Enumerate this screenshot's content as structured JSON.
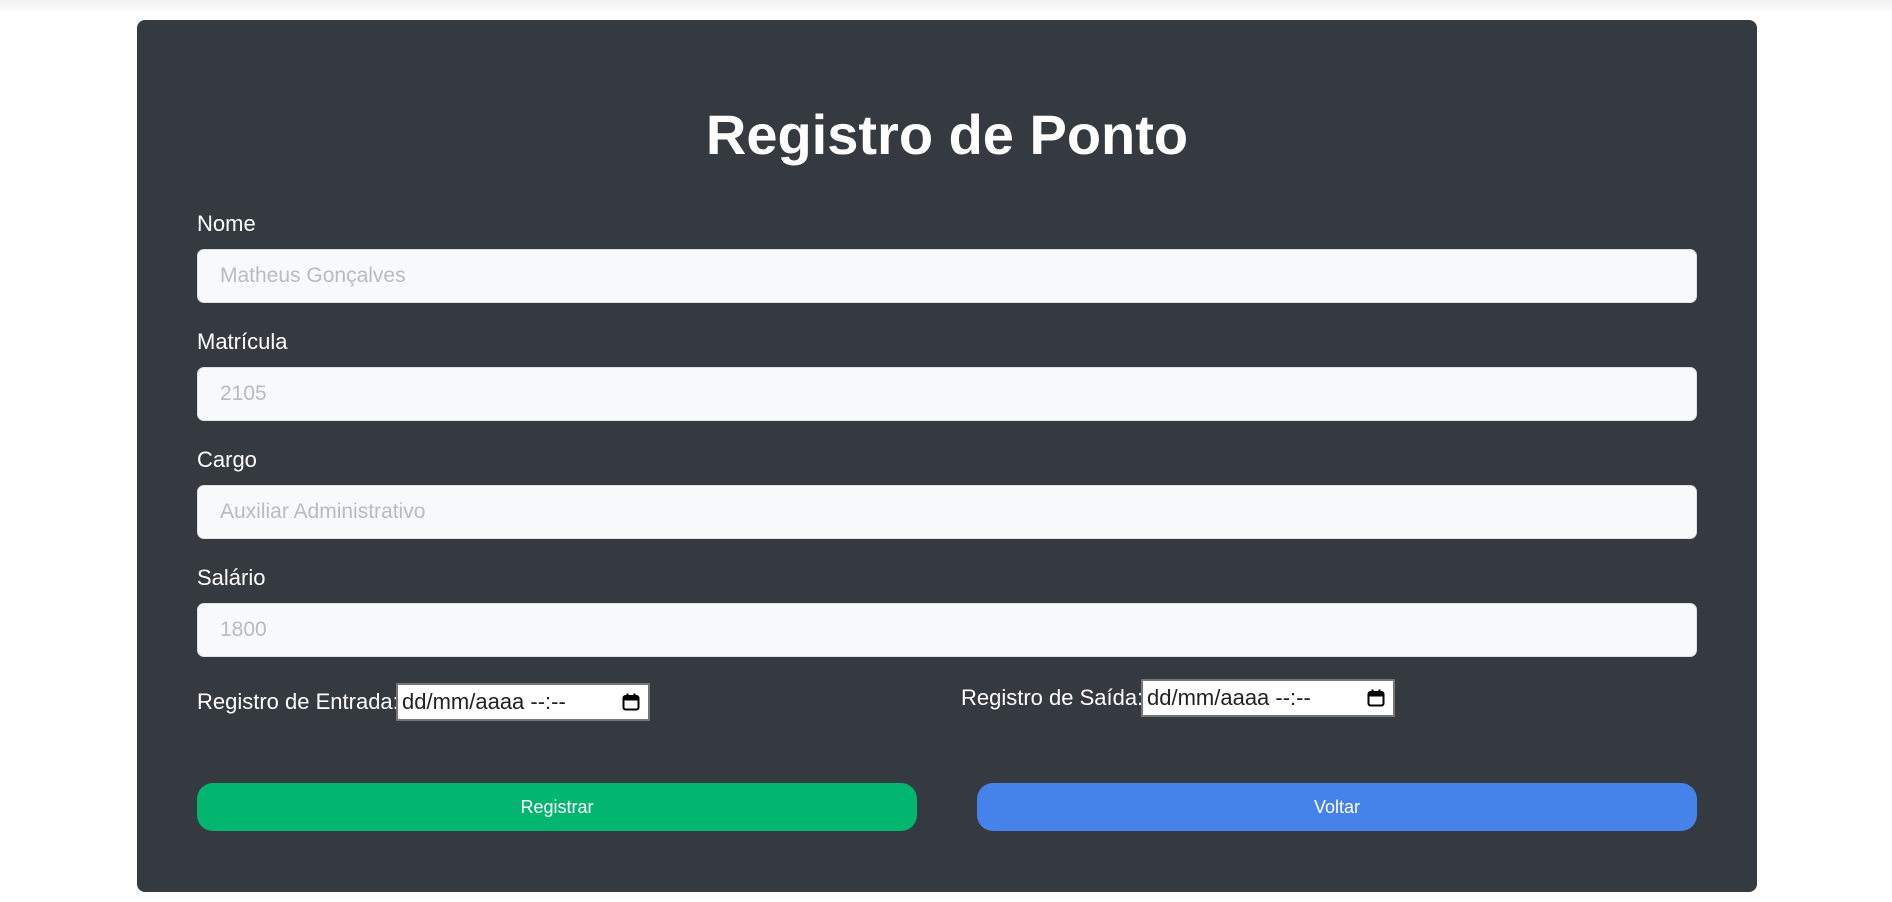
{
  "form": {
    "title": "Registro de Ponto",
    "fields": [
      {
        "label": "Nome",
        "placeholder": "Matheus Gonçalves"
      },
      {
        "label": "Matrícula",
        "placeholder": "2105"
      },
      {
        "label": "Cargo",
        "placeholder": "Auxiliar Administrativo"
      },
      {
        "label": "Salário",
        "placeholder": "1800"
      }
    ],
    "entrada": {
      "label": "Registro de Entrada:",
      "value": "dd/mm/aaaa --:--"
    },
    "saida": {
      "label": "Registro de Saída:",
      "value": "dd/mm/aaaa --:--"
    },
    "buttons": {
      "register": "Registrar",
      "back": "Voltar"
    }
  },
  "colors": {
    "card_bg": "#343a40",
    "register_button": "#03b670",
    "back_button": "#4582ea"
  },
  "icons": {
    "datetime_picker": "calendar-icon"
  }
}
